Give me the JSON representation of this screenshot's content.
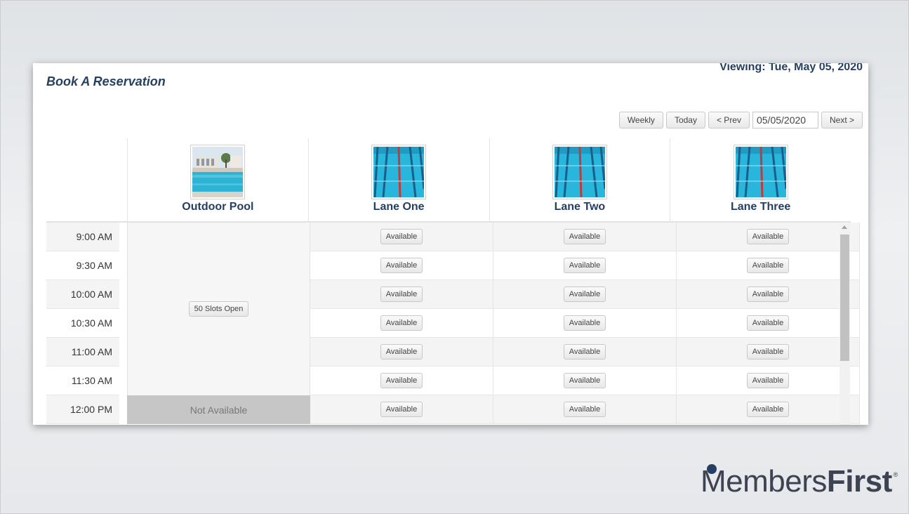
{
  "title": "Book A Reservation",
  "viewing": "Viewing: Tue, May 05, 2020",
  "toolbar": {
    "weekly": "Weekly",
    "today": "Today",
    "prev": "< Prev",
    "date": "05/05/2020",
    "next": "Next >"
  },
  "resources": [
    {
      "name": "Outdoor Pool",
      "image": "pool-photo"
    },
    {
      "name": "Lane One",
      "image": "lane-photo"
    },
    {
      "name": "Lane Two",
      "image": "lane-photo"
    },
    {
      "name": "Lane Three",
      "image": "lane-photo"
    }
  ],
  "times": [
    "9:00 AM",
    "9:30 AM",
    "10:00 AM",
    "10:30 AM",
    "11:00 AM",
    "11:30 AM",
    "12:00 PM"
  ],
  "pool": {
    "slots": "50 Slots Open",
    "not_available": "Not Available"
  },
  "slot_label": "Available",
  "logo": {
    "members": "Members",
    "first": "First",
    "reg": "®"
  },
  "colors": {
    "title": "#253f62",
    "accent": "#253f62"
  }
}
